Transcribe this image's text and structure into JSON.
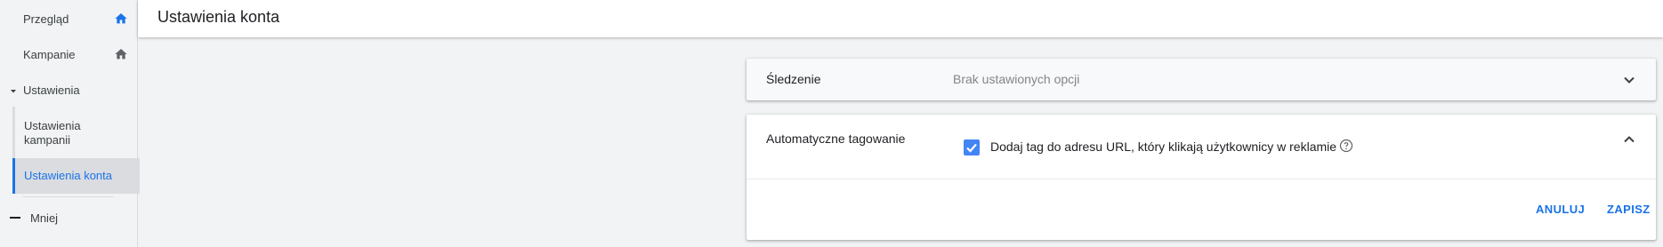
{
  "sidebar": {
    "items": [
      {
        "label": "Przegląd",
        "icon": "home-icon",
        "icon_color": "#1a73e8"
      },
      {
        "label": "Kampanie",
        "icon": "home-icon",
        "icon_color": "#5f6368"
      }
    ],
    "section": {
      "label": "Ustawienia",
      "children": [
        {
          "label": "Ustawienia kampanii",
          "active": false
        },
        {
          "label": "Ustawienia konta",
          "active": true
        }
      ]
    },
    "less_label": "Mniej"
  },
  "header": {
    "title": "Ustawienia konta"
  },
  "tracking": {
    "label": "Śledzenie",
    "value": "Brak ustawionych opcji"
  },
  "auto_tagging": {
    "label": "Automatyczne tagowanie",
    "checkbox_label": "Dodaj tag do adresu URL, który klikają użytkownicy w reklamie",
    "checked": true,
    "cancel_label": "ANULUJ",
    "save_label": "ZAPISZ"
  },
  "colors": {
    "accent": "#1a73e8",
    "checkbox": "#4285f4"
  }
}
